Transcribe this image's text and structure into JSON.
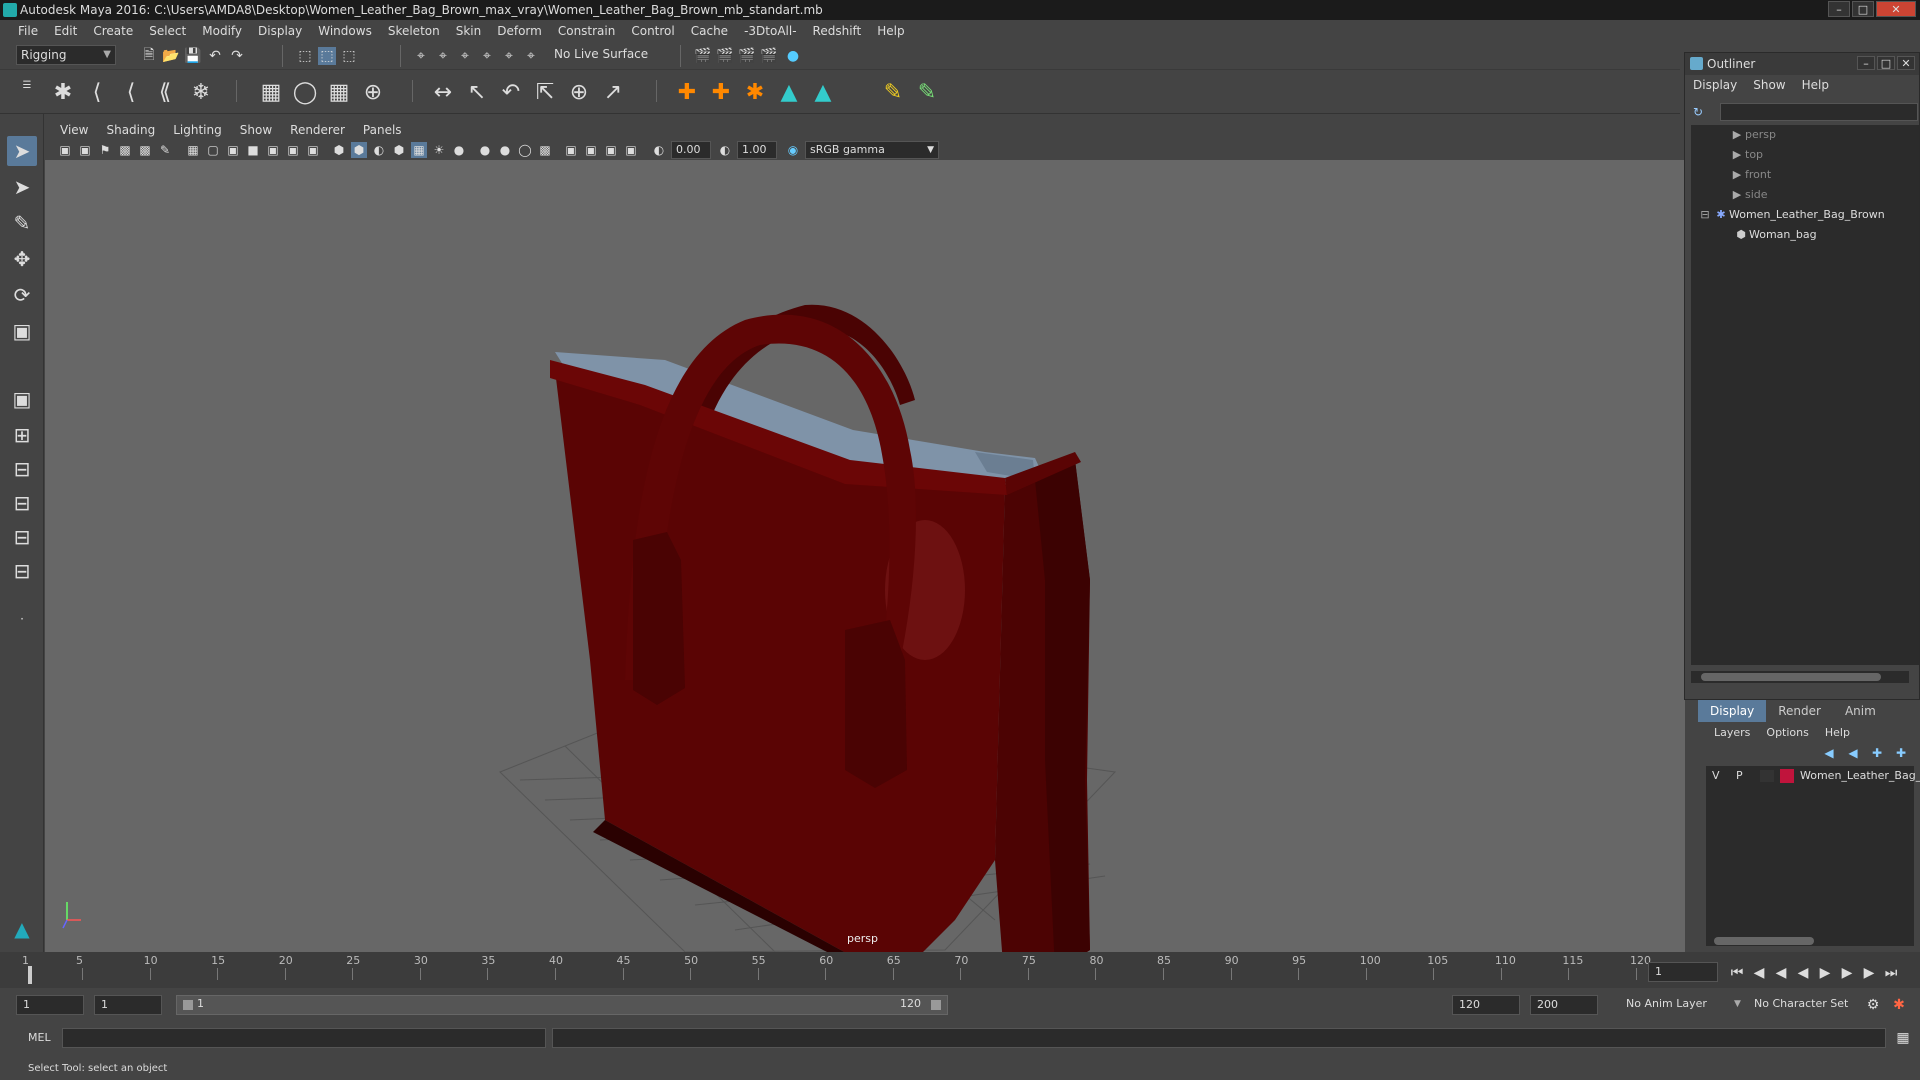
{
  "window": {
    "title": "Autodesk Maya 2016: C:\\Users\\AMDA8\\Desktop\\Women_Leather_Bag_Brown_max_vray\\Women_Leather_Bag_Brown_mb_standart.mb"
  },
  "menubar": [
    "File",
    "Edit",
    "Create",
    "Select",
    "Modify",
    "Display",
    "Windows",
    "Skeleton",
    "Skin",
    "Deform",
    "Constrain",
    "Control",
    "Cache",
    "-3DtoAll-",
    "Redshift",
    "Help"
  ],
  "toolbar": {
    "mode": "Rigging",
    "live_surface": "No Live Surface"
  },
  "viewport": {
    "menu": [
      "View",
      "Shading",
      "Lighting",
      "Show",
      "Renderer",
      "Panels"
    ],
    "exposure": "0.00",
    "gamma": "1.00",
    "color_space": "sRGB gamma",
    "camera_label": "persp",
    "bag_color": "#5a0404"
  },
  "outliner": {
    "title": "Outliner",
    "menu": [
      "Display",
      "Show",
      "Help"
    ],
    "items": [
      {
        "label": "persp",
        "type": "camera"
      },
      {
        "label": "top",
        "type": "camera"
      },
      {
        "label": "front",
        "type": "camera"
      },
      {
        "label": "side",
        "type": "camera"
      },
      {
        "label": "Women_Leather_Bag_Brown",
        "type": "group"
      },
      {
        "label": "Woman_bag",
        "type": "mesh"
      }
    ]
  },
  "layers": {
    "tabs": [
      "Display",
      "Render",
      "Anim"
    ],
    "active_tab": "Display",
    "menu": [
      "Layers",
      "Options",
      "Help"
    ],
    "row": {
      "v": "V",
      "p": "P",
      "name": "Women_Leather_Bag_",
      "color": "#c0143c"
    }
  },
  "timeline": {
    "ticks": [
      "1",
      "5",
      "10",
      "15",
      "20",
      "25",
      "30",
      "35",
      "40",
      "45",
      "50",
      "55",
      "60",
      "65",
      "70",
      "75",
      "80",
      "85",
      "90",
      "95",
      "100",
      "105",
      "110",
      "115",
      "120"
    ],
    "current_frame": "1"
  },
  "range": {
    "start": "1",
    "playback_start": "1",
    "slider_start": "1",
    "slider_end": "120",
    "playback_end": "120",
    "end": "200",
    "anim_layer": "No Anim Layer",
    "character_set": "No Character Set"
  },
  "command": {
    "label": "MEL"
  },
  "help_line": "Select Tool: select an object"
}
